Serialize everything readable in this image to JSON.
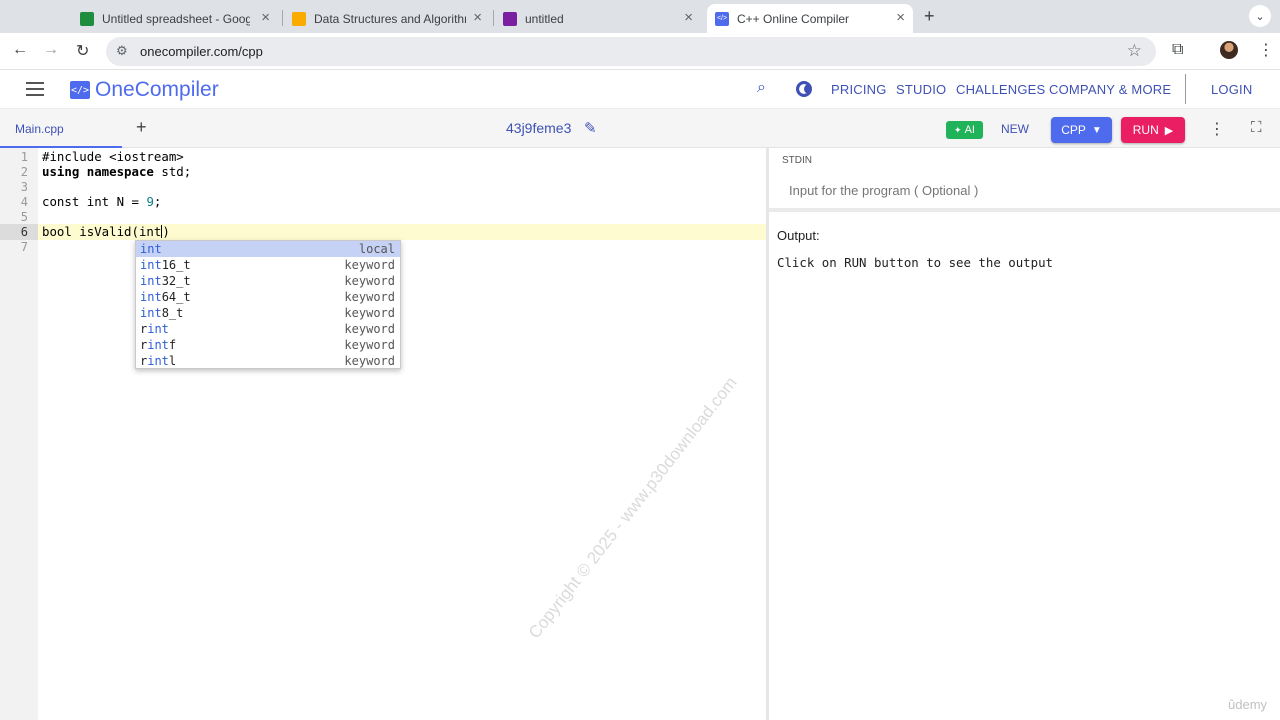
{
  "browser": {
    "tabs": [
      {
        "title": "Untitled spreadsheet - Googl",
        "favicon": "google-sheets-icon",
        "color": "#1e8e3e"
      },
      {
        "title": "Data Structures and Algorithm",
        "favicon": "google-slides-icon",
        "color": "#f9ab00"
      },
      {
        "title": "untitled",
        "favicon": "purple-app-icon",
        "color": "#7a1fa2"
      },
      {
        "title": "C++ Online Compiler",
        "favicon": "onecompiler-icon",
        "color": "#4f6bed"
      }
    ],
    "new_tab": "+",
    "url": "onecompiler.com/cpp"
  },
  "site": {
    "logo_text": "OneCompiler",
    "nav": [
      "PRICING",
      "STUDIO",
      "CHALLENGES",
      "COMPANY & MORE"
    ],
    "login": "LOGIN"
  },
  "editor_bar": {
    "file_tab": "Main.cpp",
    "add_file": "+",
    "snippet_id": "43j9feme3",
    "ai": "AI",
    "new": "NEW",
    "language": "CPP",
    "run": "RUN"
  },
  "editor": {
    "line_numbers": [
      "1",
      "2",
      "3",
      "4",
      "5",
      "6",
      "7"
    ],
    "active_line": 6
  },
  "autocomplete": [
    {
      "match": "int",
      "rest": "",
      "prefix": "",
      "kind": "local"
    },
    {
      "match": "int",
      "rest": "16_t",
      "prefix": "",
      "kind": "keyword"
    },
    {
      "match": "int",
      "rest": "32_t",
      "prefix": "",
      "kind": "keyword"
    },
    {
      "match": "int",
      "rest": "64_t",
      "prefix": "",
      "kind": "keyword"
    },
    {
      "match": "int",
      "rest": "8_t",
      "prefix": "",
      "kind": "keyword"
    },
    {
      "match": "int",
      "rest": "",
      "prefix": "r",
      "kind": "keyword"
    },
    {
      "match": "int",
      "rest": "f",
      "prefix": "r",
      "kind": "keyword"
    },
    {
      "match": "int",
      "rest": "l",
      "prefix": "r",
      "kind": "keyword"
    }
  ],
  "stdin": {
    "label": "STDIN",
    "placeholder": "Input for the program ( Optional )"
  },
  "output": {
    "label": "Output:",
    "text": "Click on RUN button to see the output"
  },
  "watermark": "Copyright © 2025 - www.p30download.com",
  "corner_mark": "ûdemy"
}
